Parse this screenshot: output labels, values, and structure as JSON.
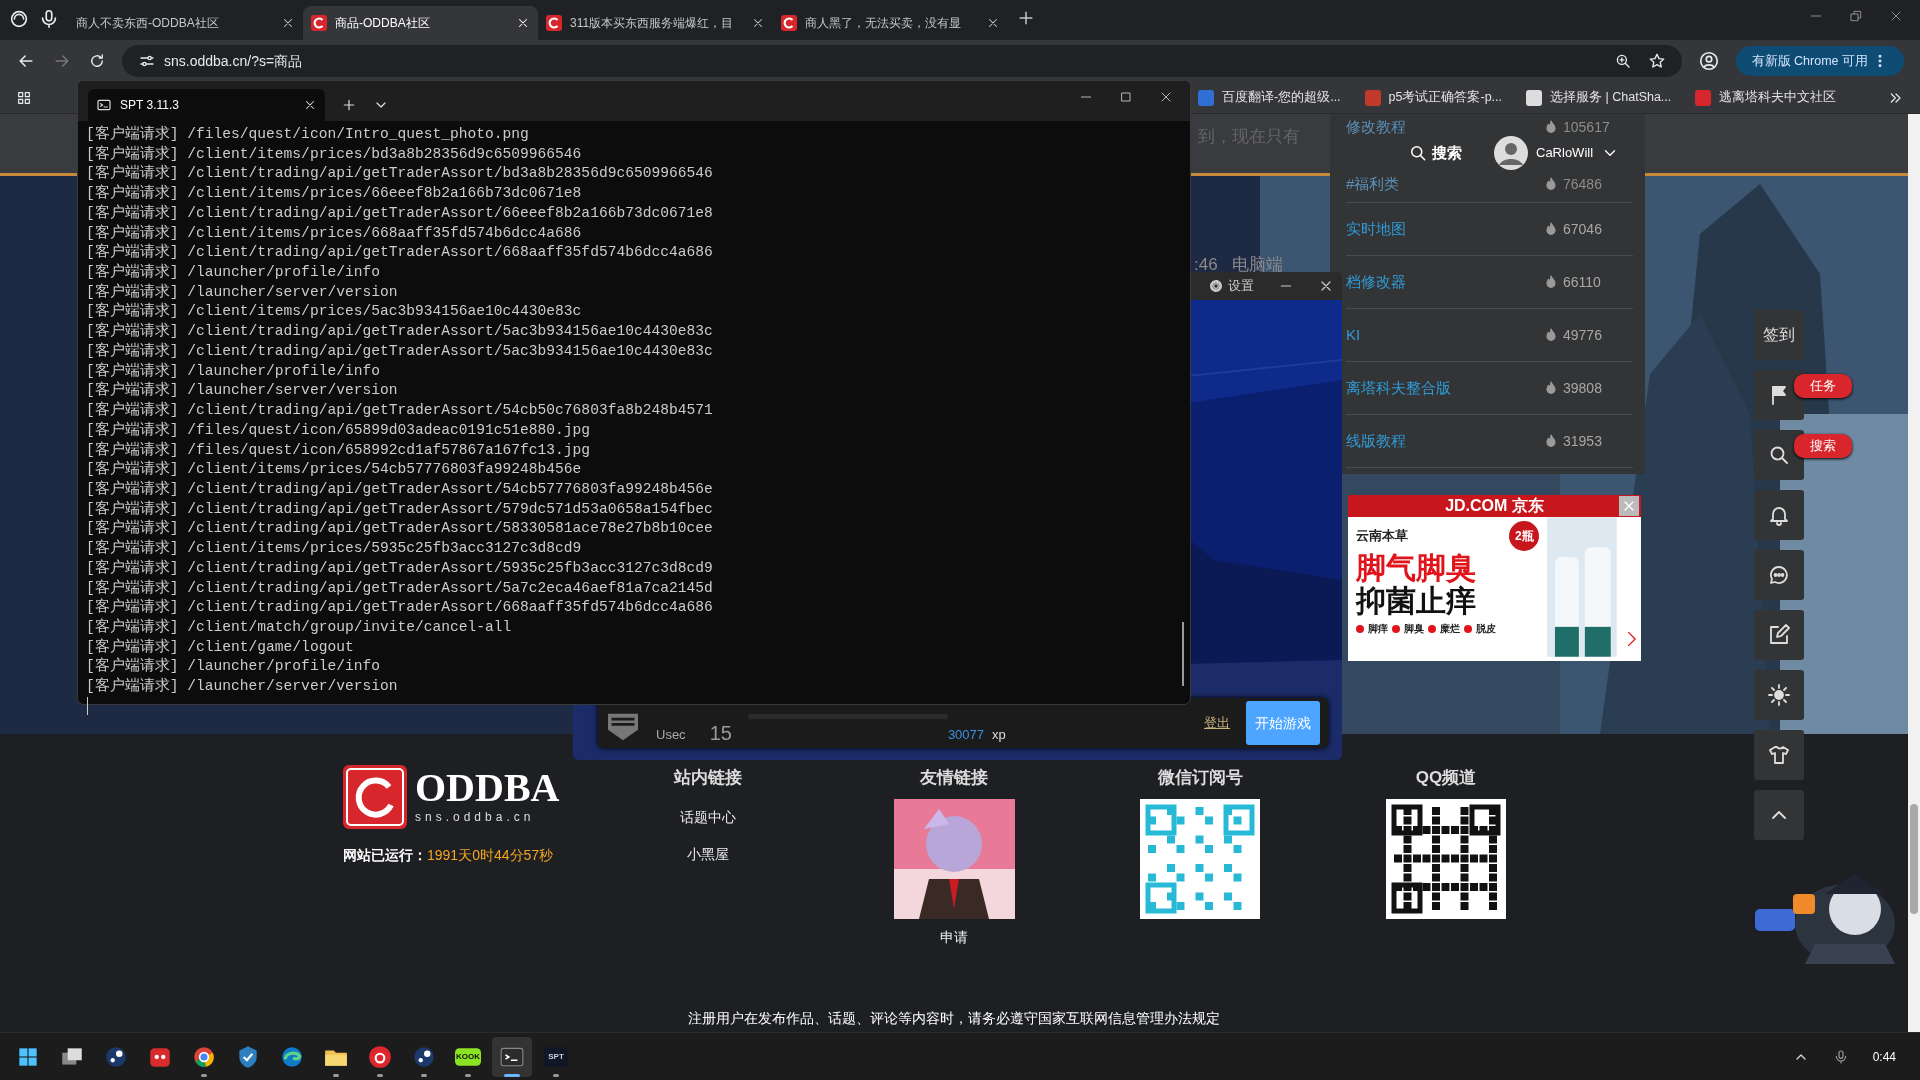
{
  "browser": {
    "tabs": [
      {
        "title": "商人不卖东西-ODDBA社区",
        "favicon": false,
        "selected": false
      },
      {
        "title": "商品-ODDBA社区",
        "favicon": true,
        "selected": true
      },
      {
        "title": "311版本买东西服务端爆红，目",
        "favicon": true,
        "selected": false
      },
      {
        "title": "商人黑了，无法买卖，没有显",
        "favicon": true,
        "selected": false
      }
    ],
    "address": "sns.oddba.cn/?s=商品",
    "update_button": "有新版 Chrome 可用",
    "bookmarks": [
      {
        "title": "百度翻译-您的超级...",
        "kind": "baidu"
      },
      {
        "title": "p5考试正确答案-p...",
        "kind": "p5"
      },
      {
        "title": "选择服务 | ChatSha...",
        "kind": "chat"
      },
      {
        "title": "逃离塔科夫中文社区",
        "kind": "oddba"
      }
    ]
  },
  "page": {
    "background_texts": [
      "到，现在只有",
      ":46",
      "电脑端"
    ],
    "header": {
      "search": "搜索",
      "user": "CaRloWill"
    },
    "hot_list": [
      {
        "title": "修改教程",
        "count": "105617",
        "dimmed": true
      },
      {
        "title": "#福利类",
        "count": "76486",
        "dimmed": true
      },
      {
        "title": "实时地图",
        "count": "67046",
        "dimmed": false
      },
      {
        "title": "档修改器",
        "count": "66110",
        "dimmed": false
      },
      {
        "title": "KI",
        "count": "49776",
        "dimmed": false
      },
      {
        "title": "离塔科夫整合版",
        "count": "39808",
        "dimmed": false
      },
      {
        "title": "线版教程",
        "count": "31953",
        "dimmed": false
      }
    ],
    "side_tools": [
      {
        "kind": "text",
        "label": "签到"
      },
      {
        "kind": "flag",
        "badge": "任务"
      },
      {
        "kind": "search",
        "badge": "搜索"
      },
      {
        "kind": "bell"
      },
      {
        "kind": "chat"
      },
      {
        "kind": "edit"
      },
      {
        "kind": "sun"
      },
      {
        "kind": "shirt"
      },
      {
        "kind": "up"
      }
    ],
    "ad": {
      "brand": "JD.COM 京东",
      "maker": "云南本草",
      "tag": "2瓶",
      "headline": "脚气脚臭",
      "subline": "抑菌止痒",
      "features": [
        "脚痒",
        "脚臭",
        "糜烂",
        "脱皮"
      ]
    },
    "footer": {
      "logo": "ODDBA",
      "domain": "sns.oddba.cn",
      "uptime_label": "网站已运行：",
      "uptime": "1991天0时44分57秒",
      "columns": [
        {
          "title": "站内链接",
          "kind": "links",
          "links": [
            "话题中心",
            "小黑屋"
          ]
        },
        {
          "title": "友情链接",
          "kind": "picture",
          "caption": "申请"
        },
        {
          "title": "微信订阅号",
          "kind": "qr"
        },
        {
          "title": "QQ频道",
          "kind": "qr"
        }
      ],
      "notice": "注册用户在发布作品、话题、评论等内容时，请务必遵守国家互联网信息管理办法规定"
    }
  },
  "launcher": {
    "settings": "设置",
    "faction": "Usec",
    "player_level": "15",
    "xp_bar": {
      "level": 0
    },
    "xp": "30077",
    "xp_unit": "xp",
    "logout": "登出",
    "start": "开始游戏"
  },
  "terminal": {
    "tab": "SPT 3.11.3",
    "lines": [
      "[客户端请求] /files/quest/icon/Intro_quest_photo.png",
      "[客户端请求] /client/items/prices/bd3a8b28356d9c6509966546",
      "[客户端请求] /client/trading/api/getTraderAssort/bd3a8b28356d9c6509966546",
      "[客户端请求] /client/items/prices/66eeef8b2a166b73dc0671e8",
      "[客户端请求] /client/trading/api/getTraderAssort/66eeef8b2a166b73dc0671e8",
      "[客户端请求] /client/items/prices/668aaff35fd574b6dcc4a686",
      "[客户端请求] /client/trading/api/getTraderAssort/668aaff35fd574b6dcc4a686",
      "[客户端请求] /launcher/profile/info",
      "[客户端请求] /launcher/server/version",
      "[客户端请求] /client/items/prices/5ac3b934156ae10c4430e83c",
      "[客户端请求] /client/trading/api/getTraderAssort/5ac3b934156ae10c4430e83c",
      "[客户端请求] /client/trading/api/getTraderAssort/5ac3b934156ae10c4430e83c",
      "[客户端请求] /launcher/profile/info",
      "[客户端请求] /launcher/server/version",
      "[客户端请求] /client/trading/api/getTraderAssort/54cb50c76803fa8b248b4571",
      "[客户端请求] /files/quest/icon/65899d03adeac0191c51e880.jpg",
      "[客户端请求] /files/quest/icon/658992cd1af57867a167fc13.jpg",
      "[客户端请求] /client/items/prices/54cb57776803fa99248b456e",
      "[客户端请求] /client/trading/api/getTraderAssort/54cb57776803fa99248b456e",
      "[客户端请求] /client/trading/api/getTraderAssort/579dc571d53a0658a154fbec",
      "[客户端请求] /client/trading/api/getTraderAssort/58330581ace78e27b8b10cee",
      "[客户端请求] /client/items/prices/5935c25fb3acc3127c3d8cd9",
      "[客户端请求] /client/trading/api/getTraderAssort/5935c25fb3acc3127c3d8cd9",
      "[客户端请求] /client/trading/api/getTraderAssort/5a7c2eca46aef81a7ca2145d",
      "[客户端请求] /client/trading/api/getTraderAssort/668aaff35fd574b6dcc4a686",
      "[客户端请求] /client/match/group/invite/cancel-all",
      "[客户端请求] /client/game/logout",
      "[客户端请求] /launcher/profile/info",
      "[客户端请求] /launcher/server/version"
    ]
  },
  "taskbar": {
    "apps": [
      {
        "kind": "windows",
        "running": false,
        "active": false
      },
      {
        "kind": "taskview",
        "running": false,
        "active": false
      },
      {
        "kind": "steam",
        "running": false,
        "active": false
      },
      {
        "kind": "redcat",
        "running": false,
        "active": false
      },
      {
        "kind": "chrome",
        "running": true,
        "active": false
      },
      {
        "kind": "shield",
        "running": false,
        "active": false
      },
      {
        "kind": "edge",
        "running": false,
        "active": false
      },
      {
        "kind": "folder",
        "running": true,
        "active": false
      },
      {
        "kind": "netease",
        "running": true,
        "active": false
      },
      {
        "kind": "steam",
        "running": true,
        "active": false
      },
      {
        "kind": "kook",
        "label": "KOOK",
        "running": true,
        "active": false
      },
      {
        "kind": "terminal",
        "running": true,
        "active": true
      },
      {
        "kind": "spt",
        "label": "SPT",
        "running": true,
        "active": false
      }
    ],
    "time": "0:44"
  }
}
